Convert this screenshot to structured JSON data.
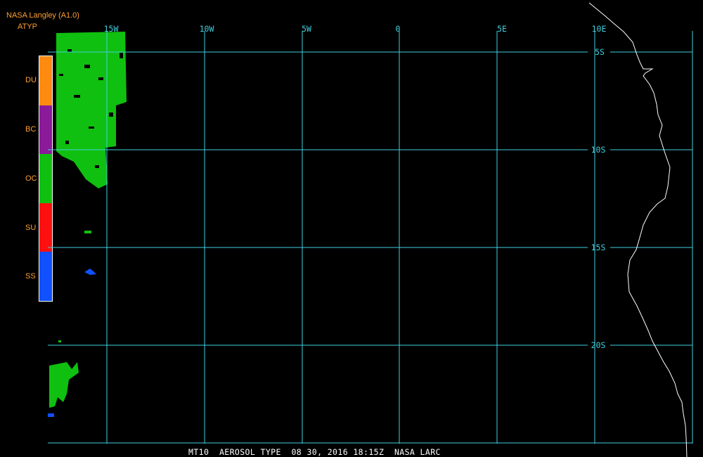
{
  "header": {
    "title": "NASA Langley (A1.0)",
    "product": "ATYP"
  },
  "legend": [
    {
      "label": "DU",
      "color": "#ff8a10"
    },
    {
      "label": "BC",
      "color": "#8a1a9a"
    },
    {
      "label": "OC",
      "color": "#10c010"
    },
    {
      "label": "SU",
      "color": "#ff1010"
    },
    {
      "label": "SS",
      "color": "#1050ff"
    }
  ],
  "map": {
    "grid_color": "#40d0e0",
    "coastline_color": "#ffffff",
    "longitude_labels": [
      "15W",
      "10W",
      "5W",
      "0",
      "5E",
      "10E"
    ],
    "latitude_labels": [
      "5S",
      "10S",
      "15S",
      "20S"
    ]
  },
  "footer": {
    "caption": "MT10  AEROSOL TYPE  08 30, 2016 18:15Z  NASA LARC"
  }
}
